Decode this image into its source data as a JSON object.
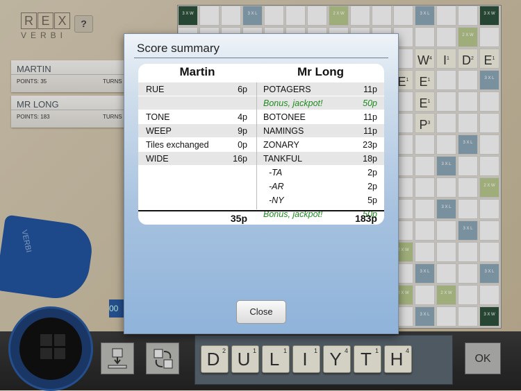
{
  "logo": {
    "letters": [
      "R",
      "E",
      "X"
    ],
    "sub": "VERBI"
  },
  "help_label": "?",
  "players": [
    {
      "name": "MARTIN",
      "points": "POINTS: 35",
      "turns": "TURNS"
    },
    {
      "name": "MR LONG",
      "points": "POINTS: 183",
      "turns": "TURNS"
    }
  ],
  "board": {
    "premium": [
      "3 X W",
      "3 X L",
      "2 X W"
    ],
    "visible_tiles": [
      {
        "letter": "W",
        "points": "4"
      },
      {
        "letter": "I",
        "points": "1"
      },
      {
        "letter": "D",
        "points": "2"
      },
      {
        "letter": "E",
        "points": "1"
      },
      {
        "letter": "E",
        "points": "1"
      },
      {
        "letter": "E",
        "points": "1"
      },
      {
        "letter": "E",
        "points": "1"
      },
      {
        "letter": "P",
        "points": "3"
      }
    ]
  },
  "side_counter": "00",
  "modal": {
    "title": "Score summary",
    "player_left": "Martin",
    "player_right": "Mr Long",
    "rows": [
      {
        "ln": "RUE",
        "lv": "6p",
        "rn": "POTAGERS",
        "rv": "11p"
      },
      {
        "ln": "",
        "lv": "",
        "rn": "Bonus, jackpot!",
        "rv": "50p",
        "bonus": true
      },
      {
        "ln": "TONE",
        "lv": "4p",
        "rn": "BOTONEE",
        "rv": "11p"
      },
      {
        "ln": "WEEP",
        "lv": "9p",
        "rn": "NAMINGS",
        "rv": "11p"
      },
      {
        "ln": "Tiles exchanged",
        "lv": "0p",
        "rn": "ZONARY",
        "rv": "23p"
      },
      {
        "ln": "WIDE",
        "lv": "16p",
        "rn": "TANKFUL",
        "rv": "18p"
      },
      {
        "ln": "",
        "lv": "",
        "rn": "-TA",
        "rv": "2p",
        "sub": true
      },
      {
        "ln": "",
        "lv": "",
        "rn": "-AR",
        "rv": "2p",
        "sub": true
      },
      {
        "ln": "",
        "lv": "",
        "rn": "-NY",
        "rv": "5p",
        "sub": true
      },
      {
        "ln": "",
        "lv": "",
        "rn": "Bonus, jackpot!",
        "rv": "50p",
        "bonus": true
      }
    ],
    "total_left": "35p",
    "total_right": "183p",
    "close_label": "Close"
  },
  "rack": [
    {
      "letter": "D",
      "points": "2"
    },
    {
      "letter": "U",
      "points": "1"
    },
    {
      "letter": "L",
      "points": "1"
    },
    {
      "letter": "I",
      "points": "1"
    },
    {
      "letter": "Y",
      "points": "4"
    },
    {
      "letter": "T",
      "points": "1"
    },
    {
      "letter": "H",
      "points": "4"
    }
  ],
  "ok_label": "OK",
  "icons": {
    "shuffle": "shuffle-icon",
    "exchange": "exchange-icon",
    "menu": "grid-menu-icon"
  }
}
